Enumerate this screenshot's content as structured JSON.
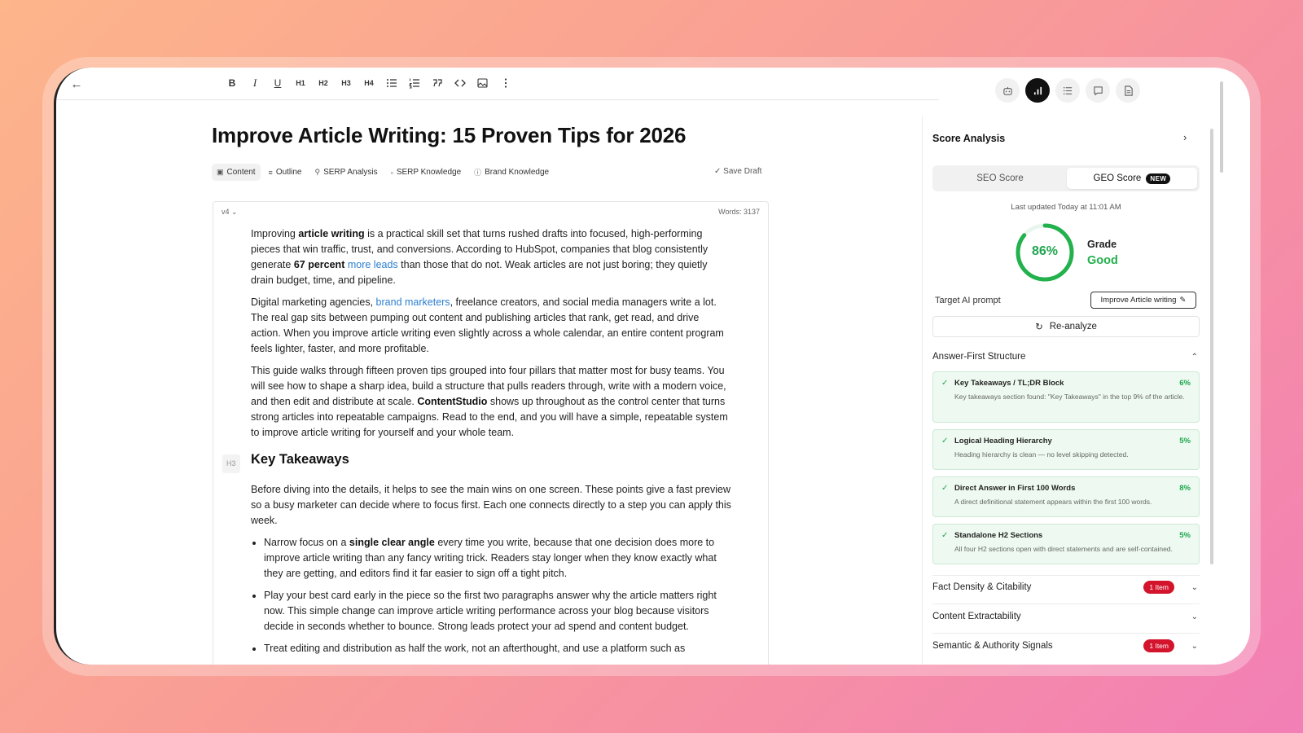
{
  "toolbar": {
    "tools": [
      "B",
      "I",
      "U",
      "H1",
      "H2",
      "H3",
      "H4"
    ]
  },
  "editor": {
    "title": "Improve Article Writing: 15 Proven Tips for 2026",
    "tabs": [
      {
        "label": "Content",
        "active": true
      },
      {
        "label": "Outline"
      },
      {
        "label": "SERP Analysis"
      },
      {
        "label": "SERP Knowledge"
      },
      {
        "label": "Brand Knowledge"
      }
    ],
    "save_label": "Save Draft",
    "version": "v4",
    "words": "Words: 3137",
    "p1": {
      "a": "Improving ",
      "b": "article writing",
      "c": " is a practical skill set that turns rushed drafts into focused, high-performing pieces that win traffic, trust, and conversions. According to HubSpot, companies that blog consistently generate ",
      "d": "67 percent",
      "e": " ",
      "link": "more leads",
      "f": " than those that do not. Weak articles are not just boring; they quietly drain budget, time, and pipeline."
    },
    "p2": {
      "a": "Digital marketing agencies, ",
      "link": "brand marketers",
      "b": ", freelance creators, and social media managers write a lot. The real gap sits between pumping out content and publishing articles that rank, get read, and drive action. When you improve article writing even slightly across a whole calendar, an entire content program feels lighter, faster, and more profitable."
    },
    "p3": {
      "a": "This guide walks through fifteen proven tips grouped into four pillars that matter most for busy teams. You will see how to shape a sharp idea, build a structure that pulls readers through, write with a modern voice, and then edit and distribute at scale. ",
      "b": "ContentStudio",
      "c": " shows up throughout as the control center that turns strong articles into repeatable campaigns. Read to the end, and you will have a simple, repeatable system to improve article writing for yourself and your whole team."
    },
    "h3_tag": "H3",
    "h3": "Key Takeaways",
    "p4": "Before diving into the details, it helps to see the main wins on one screen. These points give a fast preview so a busy marketer can decide where to focus first. Each one connects directly to a step you can apply this week.",
    "li1": {
      "a": "Narrow focus on a ",
      "b": "single clear angle",
      "c": " every time you write, because that one decision does more to improve article writing than any fancy writing trick. Readers stay longer when they know exactly what they are getting, and editors find it far easier to sign off a tight pitch."
    },
    "li2": "Play your best card early in the piece so the first two paragraphs answer why the article matters right now. This simple change can improve article writing performance across your blog because visitors decide in seconds whether to bounce. Strong leads protect your ad spend and content budget.",
    "li3": "Treat editing and distribution as half the work, not an afterthought, and use a platform such as"
  },
  "panel": {
    "title": "Score Analysis",
    "seo_tab": "SEO Score",
    "geo_tab": "GEO Score",
    "new_badge": "NEW",
    "last_updated": "Last updated Today at 11:01 AM",
    "score_label": "86%",
    "score_value": 86,
    "grade_label": "Grade",
    "grade_value": "Good",
    "target_label": "Target AI prompt",
    "target_value": "Improve Article writing",
    "reanalyze": "Re-analyze",
    "section1": "Answer-First Structure",
    "checks": [
      {
        "title": "Key Takeaways / TL;DR Block",
        "pct": "6%",
        "desc": "Key takeaways section found: \"Key Takeaways\" in the top 9% of the article."
      },
      {
        "title": "Logical Heading Hierarchy",
        "pct": "5%",
        "desc": "Heading hierarchy is clean — no level skipping detected."
      },
      {
        "title": "Direct Answer in First 100 Words",
        "pct": "8%",
        "desc": "A direct definitional statement appears within the first 100 words."
      },
      {
        "title": "Standalone H2 Sections",
        "pct": "5%",
        "desc": "All four H2 sections open with direct statements and are self-contained."
      }
    ],
    "section2": "Fact Density & Citability",
    "section2_badge": "1 Item",
    "section3": "Content Extractability",
    "section4": "Semantic & Authority Signals",
    "section4_badge": "1 Item"
  },
  "colors": {
    "accent_green": "#1fa64f",
    "badge_red": "#d4142c",
    "link_blue": "#2b7fd0"
  }
}
